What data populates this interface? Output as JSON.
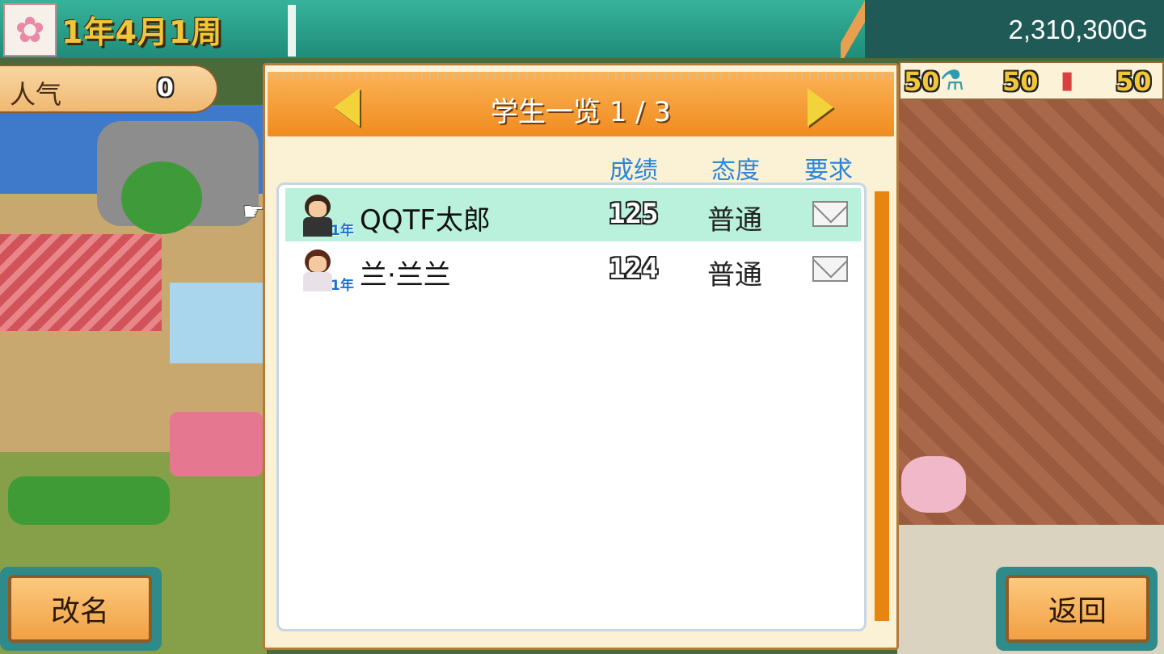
{
  "header": {
    "date": "1年4月1周",
    "money": "2,310,300G"
  },
  "popularity": {
    "label": "人气",
    "value": "0"
  },
  "stats": {
    "first_value": "50",
    "flask_value": "50",
    "gas_value": "50"
  },
  "dialog": {
    "title": "学生一览 1 / 3",
    "columns": {
      "grades": "成绩",
      "attitude": "态度",
      "request": "要求"
    },
    "students": [
      {
        "grade_tag": "1年",
        "name": "QQTF太郎",
        "score": "125",
        "attitude": "普通"
      },
      {
        "grade_tag": "1年",
        "name": "兰·兰兰",
        "score": "124",
        "attitude": "普通"
      }
    ]
  },
  "buttons": {
    "rename": "改名",
    "back": "返回"
  },
  "colors": {
    "topbar": "#1f8c79",
    "header_orange": "#f08b1f",
    "selected_row": "#b9f1dc",
    "column_head_blue": "#2e86d8"
  }
}
